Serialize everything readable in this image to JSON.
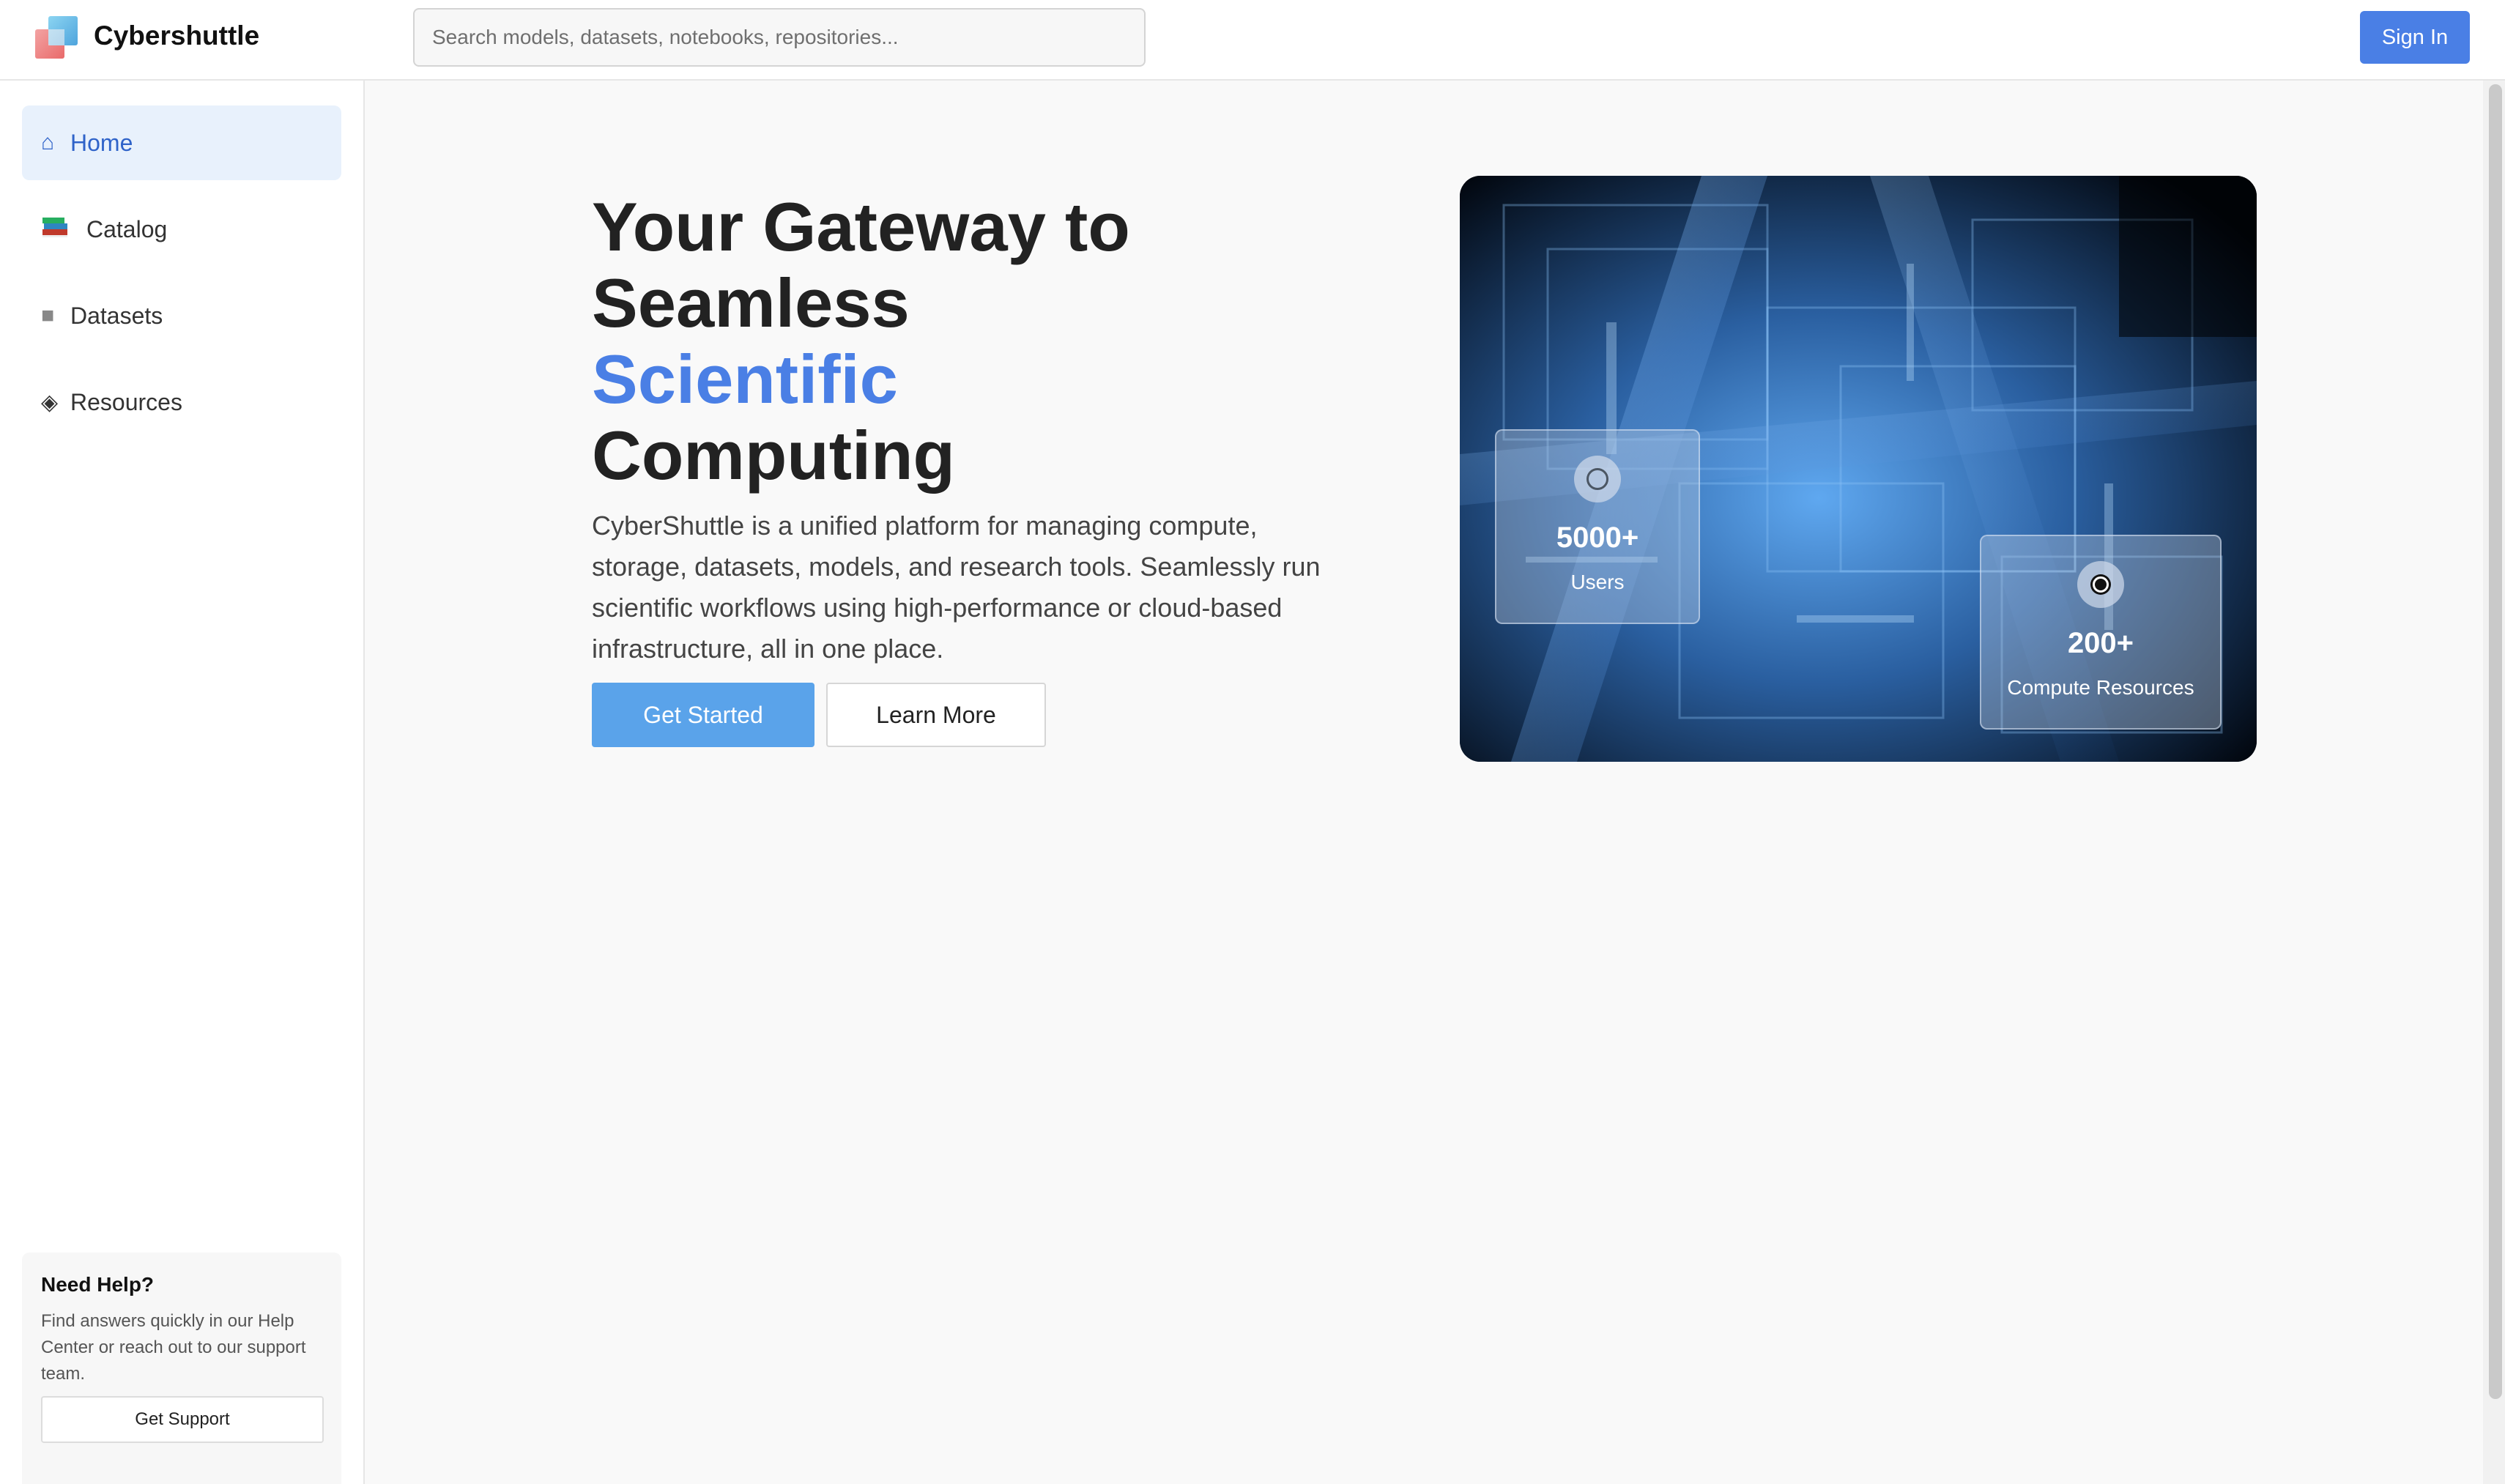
{
  "header": {
    "brand": "Cybershuttle",
    "search_placeholder": "Search models, datasets, notebooks, repositories...",
    "sign_in": "Sign In"
  },
  "sidebar": {
    "items": [
      {
        "label": "Home",
        "icon": "home-icon",
        "active": true
      },
      {
        "label": "Catalog",
        "icon": "books-icon"
      },
      {
        "label": "Datasets",
        "icon": "square-icon"
      },
      {
        "label": "Resources",
        "icon": "diamond-icon"
      }
    ],
    "help": {
      "title": "Need Help?",
      "text": "Find answers quickly in our Help Center or reach out to our support team.",
      "button": "Get Support"
    }
  },
  "hero": {
    "title_line1": "Your Gateway to",
    "title_line2": "Seamless",
    "title_accent": "Scientific",
    "title_line4": "Computing",
    "description": "CyberShuttle is a unified platform for managing compute, storage, datasets, models, and research tools. Seamlessly run scientific workflows using high-performance or cloud-based infrastructure, all in one place.",
    "primary_button": "Get Started",
    "secondary_button": "Learn More",
    "stats": [
      {
        "value": "5000+",
        "label": "Users"
      },
      {
        "value": "200+",
        "label": "Compute Resources"
      }
    ]
  },
  "colors": {
    "accent": "#4a7fe5",
    "primary_button": "#5aa3ea"
  }
}
